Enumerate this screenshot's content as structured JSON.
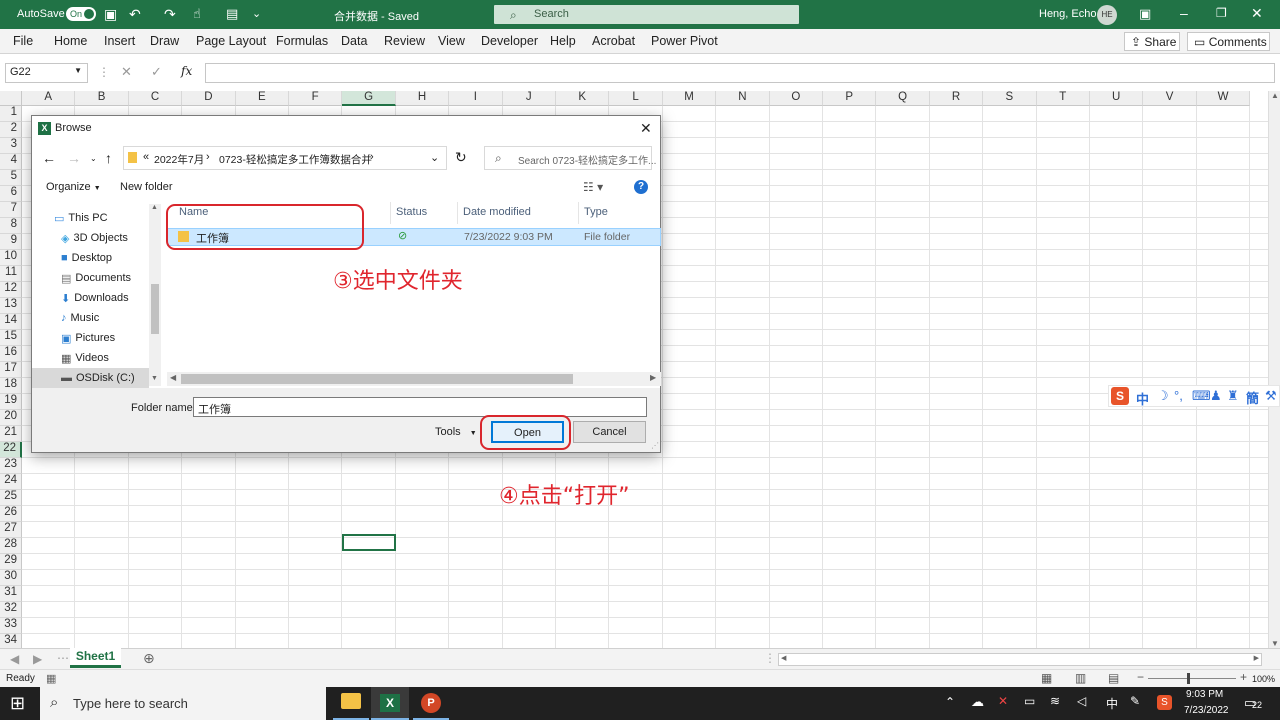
{
  "titlebar": {
    "autosave_label": "AutoSave",
    "autosave_state": "On",
    "doc_title": "合并数据 - Saved",
    "search_placeholder": "Search",
    "user_name": "Heng, Echo",
    "user_initials": "HE"
  },
  "menu": {
    "items": [
      "File",
      "Home",
      "Insert",
      "Draw",
      "Page Layout",
      "Formulas",
      "Data",
      "Review",
      "View",
      "Developer",
      "Help",
      "Acrobat",
      "Power Pivot"
    ],
    "share_label": "Share",
    "comments_label": "Comments"
  },
  "formula_bar": {
    "name_box": "G22",
    "fx_label": "fx"
  },
  "grid": {
    "columns": [
      "A",
      "B",
      "C",
      "D",
      "E",
      "F",
      "G",
      "H",
      "I",
      "J",
      "K",
      "L",
      "M",
      "N",
      "O",
      "P",
      "Q",
      "R",
      "S",
      "T",
      "U",
      "V",
      "W"
    ],
    "rows": [
      "1",
      "2",
      "3",
      "4",
      "5",
      "6",
      "7",
      "8",
      "9",
      "10",
      "11",
      "12",
      "13",
      "14",
      "15",
      "16",
      "17",
      "18",
      "19",
      "20",
      "21",
      "22",
      "23",
      "24",
      "25",
      "26",
      "27",
      "28",
      "29",
      "30",
      "31",
      "32",
      "33",
      "34"
    ],
    "selected_cell": "G22"
  },
  "sheet": {
    "tab_label": "Sheet1"
  },
  "status": {
    "ready": "Ready",
    "zoom": "100%"
  },
  "dialog": {
    "title": "Browse",
    "breadcrumb": [
      "2022年7月",
      "0723-轻松搞定多工作簿数据合并"
    ],
    "search_placeholder": "Search 0723-轻松搞定多工作...",
    "organize_label": "Organize",
    "new_folder_label": "New folder",
    "nav_items": [
      "This PC",
      "3D Objects",
      "Desktop",
      "Documents",
      "Downloads",
      "Music",
      "Pictures",
      "Videos",
      "OSDisk (C:)"
    ],
    "columns": [
      "Name",
      "Status",
      "Date modified",
      "Type"
    ],
    "files": [
      {
        "name": "工作簿",
        "date": "7/23/2022 9:03 PM",
        "type": "File folder"
      }
    ],
    "folder_name_label": "Folder name:",
    "folder_name_value": "工作簿",
    "tools_label": "Tools",
    "open_label": "Open",
    "cancel_label": "Cancel"
  },
  "annotations": {
    "step3": "③选中文件夹",
    "step4": "④点击“打开”"
  },
  "ime": {
    "text": "中"
  },
  "taskbar": {
    "search_placeholder": "Type here to search",
    "time": "9:03 PM",
    "date": "7/23/2022",
    "ime_lang": "中",
    "notification_count": "22"
  },
  "colors": {
    "excel_green": "#217346",
    "annotation_red": "#e0262e",
    "selection_blue": "#cce8ff"
  }
}
